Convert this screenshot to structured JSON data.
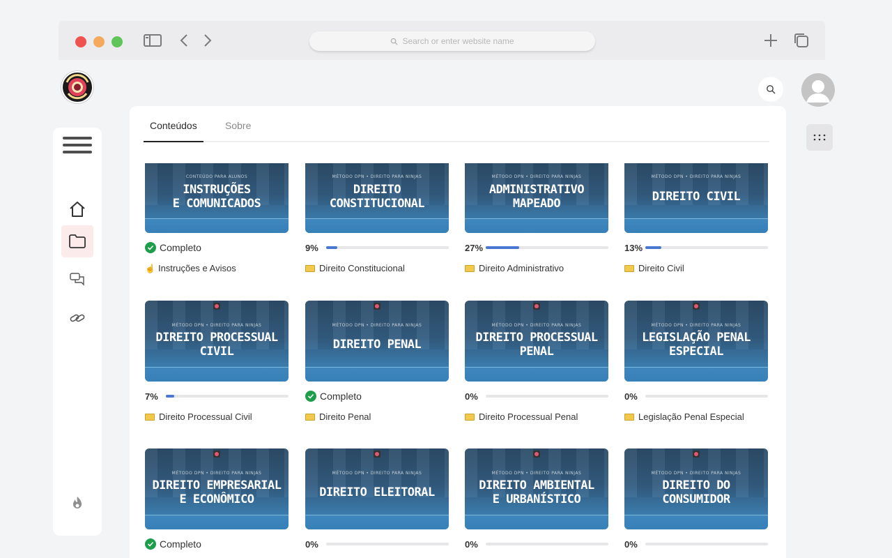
{
  "browser": {
    "url_placeholder": "Search or enter website name"
  },
  "logo": {
    "text": "Direito Para Ninjas"
  },
  "sidebar": {
    "items": [
      "home",
      "folder",
      "chat",
      "link"
    ]
  },
  "tabs": [
    {
      "label": "Conteúdos",
      "active": true
    },
    {
      "label": "Sobre",
      "active": false
    }
  ],
  "courses": [
    {
      "kicker": "CONTEÚDO PARA ALUNOS",
      "thumb_title": "INSTRUÇÕES\nE COMUNICADOS",
      "complete": true,
      "status": "Completo",
      "progress": 100,
      "label": "Instruções e Avisos",
      "icon": "pointing-hand-icon"
    },
    {
      "kicker": "MÉTODO DPN • DIREITO PARA NINJAS",
      "thumb_title": "DIREITO\nCONSTITUCIONAL",
      "complete": false,
      "status": "9%",
      "progress": 9,
      "label": "Direito Constitucional",
      "icon": "folder-icon"
    },
    {
      "kicker": "MÉTODO DPN • DIREITO PARA NINJAS",
      "thumb_title": "ADMINISTRATIVO\nMAPEADO",
      "complete": false,
      "status": "27%",
      "progress": 27,
      "label": "Direito Administrativo",
      "icon": "folder-icon"
    },
    {
      "kicker": "MÉTODO DPN • DIREITO PARA NINJAS",
      "thumb_title": "DIREITO CIVIL",
      "complete": false,
      "status": "13%",
      "progress": 13,
      "label": "Direito Civil",
      "icon": "folder-icon"
    },
    {
      "kicker": "MÉTODO DPN • DIREITO PARA NINJAS",
      "thumb_title": "DIREITO PROCESSUAL\nCIVIL",
      "complete": false,
      "status": "7%",
      "progress": 7,
      "label": "Direito Processual Civil",
      "icon": "folder-icon"
    },
    {
      "kicker": "MÉTODO DPN • DIREITO PARA NINJAS",
      "thumb_title": "DIREITO PENAL",
      "complete": true,
      "status": "Completo",
      "progress": 100,
      "label": "Direito Penal",
      "icon": "folder-icon"
    },
    {
      "kicker": "MÉTODO DPN • DIREITO PARA NINJAS",
      "thumb_title": "DIREITO PROCESSUAL\nPENAL",
      "complete": false,
      "status": "0%",
      "progress": 0,
      "label": "Direito Processual Penal",
      "icon": "folder-icon"
    },
    {
      "kicker": "MÉTODO DPN • DIREITO PARA NINJAS",
      "thumb_title": "LEGISLAÇÃO PENAL\nESPECIAL",
      "complete": false,
      "status": "0%",
      "progress": 0,
      "label": "Legislação Penal Especial",
      "icon": "folder-icon"
    },
    {
      "kicker": "MÉTODO DPN • DIREITO PARA NINJAS",
      "thumb_title": "DIREITO EMPRESARIAL\nE ECONÔMICO",
      "complete": true,
      "status": "Completo",
      "progress": 100,
      "label": "",
      "icon": "folder-icon"
    },
    {
      "kicker": "MÉTODO DPN • DIREITO PARA NINJAS",
      "thumb_title": "DIREITO ELEITORAL",
      "complete": false,
      "status": "0%",
      "progress": 0,
      "label": "",
      "icon": "folder-icon"
    },
    {
      "kicker": "MÉTODO DPN • DIREITO PARA NINJAS",
      "thumb_title": "DIREITO AMBIENTAL\nE URBANÍSTICO",
      "complete": false,
      "status": "0%",
      "progress": 0,
      "label": "",
      "icon": "folder-icon"
    },
    {
      "kicker": "MÉTODO DPN • DIREITO PARA NINJAS",
      "thumb_title": "DIREITO DO\nCONSUMIDOR",
      "complete": false,
      "status": "0%",
      "progress": 0,
      "label": "",
      "icon": "folder-icon"
    }
  ],
  "colors": {
    "accent": "#4a78d0",
    "complete": "#1e9e4a",
    "thumb_top": "#2c4c68",
    "thumb_bottom": "#4a95c8"
  }
}
